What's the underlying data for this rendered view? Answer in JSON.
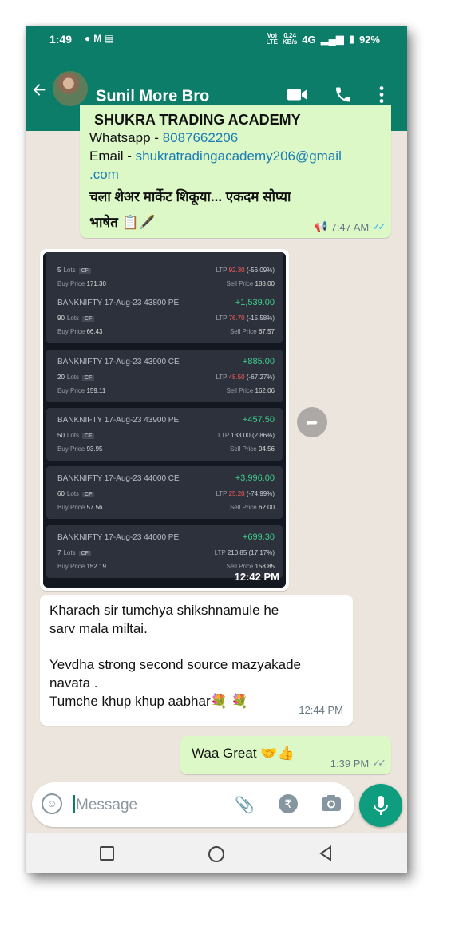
{
  "status_bar": {
    "time": "1:49",
    "notif_icons": [
      "chat-bubble-icon",
      "gmail-icon",
      "news-icon"
    ],
    "network_rate_top": "0.24",
    "network_rate_bottom": "KB/s",
    "network_type": "4G",
    "volte": "VoLTE",
    "battery": "92%"
  },
  "app_bar": {
    "contact_name": "Sunil More Bro",
    "accent": "#0b7d68"
  },
  "messages": {
    "m1": {
      "title": "SHUKRA TRADING ACADEMY",
      "whatsapp_label": "Whatsapp - ",
      "whatsapp_number": "8087662206",
      "email_label": "Email - ",
      "email_value": "shukratradingacademy206@gmail",
      "email_tail": ".com",
      "marathi_line1": "चला शेअर मार्केट शिकूया... एकदम सोप्या",
      "marathi_line2": "भाषेत",
      "emoji": "📋🖋️",
      "time": "7:47 AM"
    },
    "m2": {
      "time": "12:42 PM",
      "cards": [
        {
          "symbol": "",
          "pnl": "",
          "lots": "5",
          "ltp": "92.30",
          "ltp_change": "(-56.09%)",
          "buy": "171.30",
          "sell": "188.00",
          "ltp_negative": true
        },
        {
          "symbol": "BANKNIFTY 17-Aug-23 43800 PE",
          "pnl": "+1,539.00",
          "lots": "90",
          "ltp": "76.70",
          "ltp_change": "(-15.58%)",
          "buy": "66.43",
          "sell": "67.57",
          "ltp_negative": true
        },
        {
          "symbol": "BANKNIFTY 17-Aug-23 43900 CE",
          "pnl": "+885.00",
          "lots": "20",
          "ltp": "48.50",
          "ltp_change": "(-67.27%)",
          "buy": "159.11",
          "sell": "162.06",
          "ltp_negative": true
        },
        {
          "symbol": "BANKNIFTY 17-Aug-23 43900 PE",
          "pnl": "+457.50",
          "lots": "50",
          "ltp": "133.00",
          "ltp_change": "(2.86%)",
          "buy": "93.95",
          "sell": "94.56",
          "ltp_negative": false
        },
        {
          "symbol": "BANKNIFTY 17-Aug-23 44000 CE",
          "pnl": "+3,996.00",
          "lots": "60",
          "ltp": "25.20",
          "ltp_change": "(-74.99%)",
          "buy": "57.56",
          "sell": "62.00",
          "ltp_negative": true
        },
        {
          "symbol": "BANKNIFTY 17-Aug-23 44000 PE",
          "pnl": "+699.30",
          "lots": "7",
          "ltp": "210.85",
          "ltp_change": "(17.17%)",
          "buy": "152.19",
          "sell": "158.85",
          "ltp_negative": false
        }
      ],
      "labels": {
        "lots": "Lots",
        "cf": "CF",
        "ltp": "LTP",
        "buy": "Buy Price",
        "sell": "Sell Price"
      }
    },
    "m3": {
      "line1": "Kharach sir tumchya shikshnamule he",
      "line2": "sarv mala miltai.",
      "line3": "Yevdha strong second source mazyakade",
      "line4": "navata .",
      "line5": "Tumche khup khup aabhar",
      "emoji": "💐 💐",
      "time": "12:44 PM"
    },
    "m4": {
      "text": "Waa Great ",
      "emoji": "🤝👍",
      "time": "1:39 PM"
    }
  },
  "composer": {
    "placeholder": "Message"
  }
}
